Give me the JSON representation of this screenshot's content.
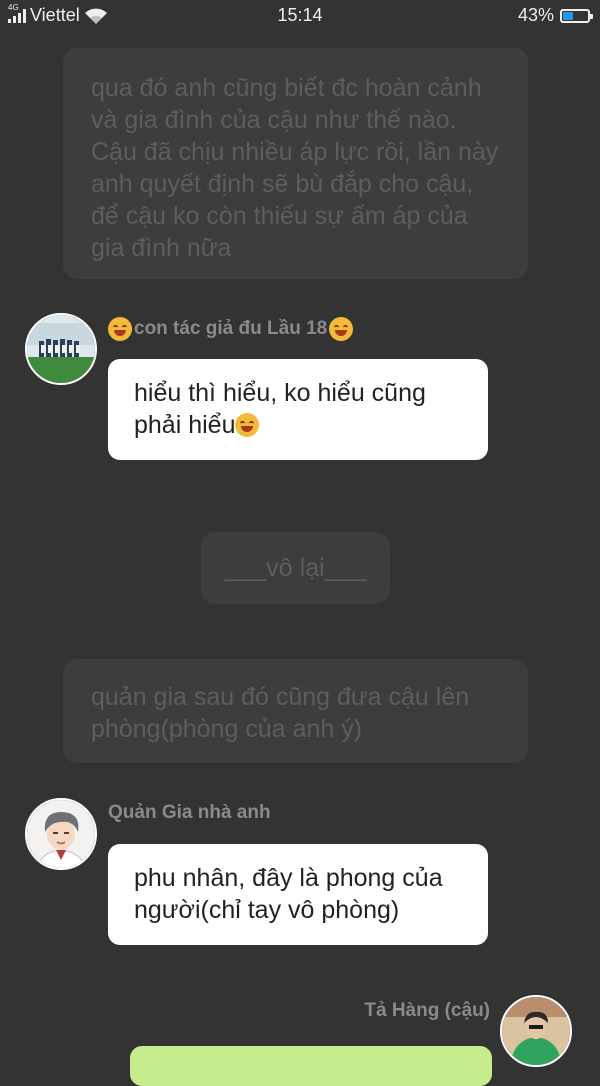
{
  "status_bar": {
    "network_type": "4G",
    "carrier": "Viettel",
    "time": "15:14",
    "battery_percent": "43%",
    "battery_level": 0.43,
    "icons": [
      "signal-icon",
      "wifi-icon",
      "battery-icon"
    ]
  },
  "messages": [
    {
      "type": "narration",
      "text": "qua đó anh cũng biết đc hoàn cảnh và gia đình của cậu như thế nào. Cậu đã chịu nhiều áp lực rồi, lần này anh quyết định sẽ bù đắp cho cậu, để cậu ko còn thiếu sự ấm áp của gia đình nữa"
    },
    {
      "type": "incoming",
      "sender": "con tác giả đu Lầu 18",
      "text": "hiểu thì hiểu, ko hiểu cũng phải hiểu",
      "avatar": "group-photo-avatar"
    },
    {
      "type": "narration",
      "text": "___vô lại___"
    },
    {
      "type": "narration",
      "text": "quản gia sau đó cũng đưa cậu lên phòng(phòng của anh ý)"
    },
    {
      "type": "incoming",
      "sender": "Quản Gia nhà anh",
      "text": "phu nhân, đây là phong của người(chỉ tay vô phòng)",
      "avatar": "anime-butler-avatar"
    },
    {
      "type": "outgoing",
      "sender": "Tả Hàng (cậu)",
      "text": "",
      "avatar": "green-jacket-avatar"
    }
  ],
  "colors": {
    "background": "#333333",
    "narration_bg": "#3d3d3d",
    "narration_text": "#5d5d5d",
    "incoming_bubble": "#ffffff",
    "outgoing_bubble": "#c6ec8f",
    "name_text": "#8a8a8a"
  }
}
